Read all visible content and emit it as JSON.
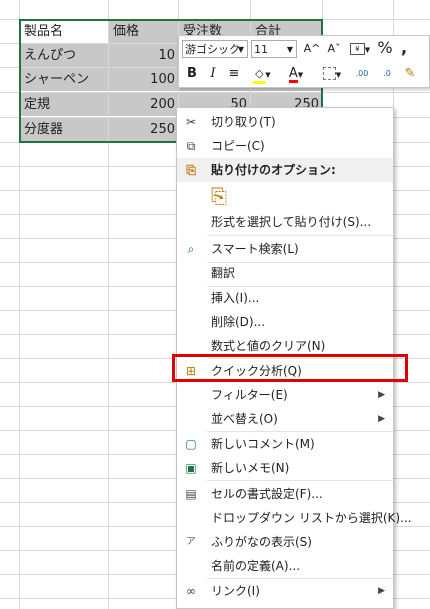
{
  "table": {
    "headers": [
      "製品名",
      "価格",
      "受注数",
      "合計"
    ],
    "rows": [
      {
        "name": "えんぴつ",
        "price": "10",
        "qty": "",
        "total": ""
      },
      {
        "name": "シャーペン",
        "price": "100",
        "qty": "",
        "total": ""
      },
      {
        "name": "定規",
        "price": "200",
        "qty": "50",
        "total": "250"
      },
      {
        "name": "分度器",
        "price": "250",
        "qty": "",
        "total": ""
      }
    ]
  },
  "mini_toolbar": {
    "font_name": "游ゴシック",
    "font_size": "11",
    "grow_font": "A^",
    "shrink_font": "Aˇ",
    "percent": "%",
    "comma": "❹",
    "bold": "B",
    "italic": "I",
    "align": "≡",
    "font_color": "A",
    "dec_increase": ".00",
    "dec_decrease": ".0"
  },
  "context_menu": {
    "items": [
      {
        "label": "切り取り(T)",
        "icon": "scissors-icon",
        "glyph": "✂"
      },
      {
        "label": "コピー(C)",
        "icon": "copy-icon",
        "glyph": "⧉"
      },
      {
        "label": "貼り付けのオプション:",
        "icon": "paste-icon",
        "glyph": "⎘"
      },
      {
        "label": "形式を選択して貼り付け(S)...",
        "icon": "",
        "glyph": ""
      },
      {
        "label": "スマート検索(L)",
        "icon": "smart-lookup-icon",
        "glyph": "⌕"
      },
      {
        "label": "翻訳",
        "icon": "",
        "glyph": ""
      },
      {
        "label": "挿入(I)...",
        "icon": "",
        "glyph": ""
      },
      {
        "label": "削除(D)...",
        "icon": "",
        "glyph": ""
      },
      {
        "label": "数式と値のクリア(N)",
        "icon": "",
        "glyph": ""
      },
      {
        "label": "クイック分析(Q)",
        "icon": "quick-analysis-icon",
        "glyph": "⊞"
      },
      {
        "label": "フィルター(E)",
        "icon": "",
        "glyph": ""
      },
      {
        "label": "並べ替え(O)",
        "icon": "",
        "glyph": ""
      },
      {
        "label": "新しいコメント(M)",
        "icon": "new-comment-icon",
        "glyph": "▢"
      },
      {
        "label": "新しいメモ(N)",
        "icon": "new-note-icon",
        "glyph": "▣"
      },
      {
        "label": "セルの書式設定(F)...",
        "icon": "format-cells-icon",
        "glyph": "▤"
      },
      {
        "label": "ドロップダウン リストから選択(K)...",
        "icon": "",
        "glyph": ""
      },
      {
        "label": "ふりがなの表示(S)",
        "icon": "furigana-icon",
        "glyph": "ア"
      },
      {
        "label": "名前の定義(A)...",
        "icon": "",
        "glyph": ""
      },
      {
        "label": "リンク(I)",
        "icon": "link-icon",
        "glyph": "∞"
      }
    ],
    "paste_option_glyph": "⎘"
  },
  "colors": {
    "selection_border": "#217346",
    "highlight": "#e00000",
    "selected_cell": "#c8c8c8"
  }
}
